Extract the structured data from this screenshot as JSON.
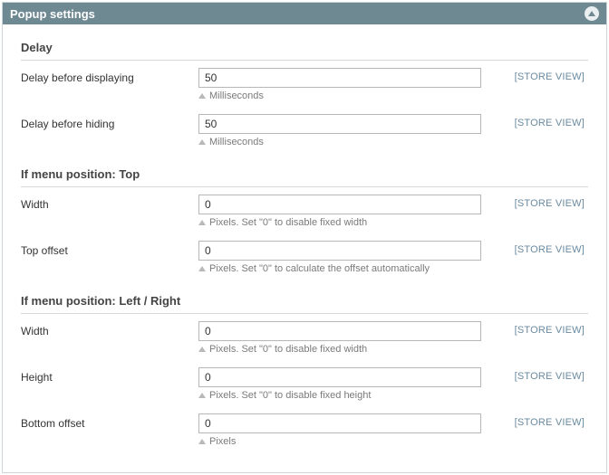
{
  "header": {
    "title": "Popup settings"
  },
  "scope_label": "[STORE VIEW]",
  "groups": [
    {
      "heading": "Delay",
      "fields": [
        {
          "id": "delay-display",
          "label": "Delay before displaying",
          "value": "50",
          "note": "Milliseconds"
        },
        {
          "id": "delay-hide",
          "label": "Delay before hiding",
          "value": "50",
          "note": "Milliseconds"
        }
      ]
    },
    {
      "heading": "If menu position: Top",
      "fields": [
        {
          "id": "top-width",
          "label": "Width",
          "value": "0",
          "note": "Pixels. Set \"0\" to disable fixed width"
        },
        {
          "id": "top-offset",
          "label": "Top offset",
          "value": "0",
          "note": "Pixels. Set \"0\" to calculate the offset automatically"
        }
      ]
    },
    {
      "heading": "If menu position: Left / Right",
      "fields": [
        {
          "id": "lr-width",
          "label": "Width",
          "value": "0",
          "note": "Pixels. Set \"0\" to disable fixed width"
        },
        {
          "id": "lr-height",
          "label": "Height",
          "value": "0",
          "note": "Pixels. Set \"0\" to disable fixed height"
        },
        {
          "id": "lr-bottom",
          "label": "Bottom offset",
          "value": "0",
          "note": "Pixels"
        }
      ]
    }
  ]
}
